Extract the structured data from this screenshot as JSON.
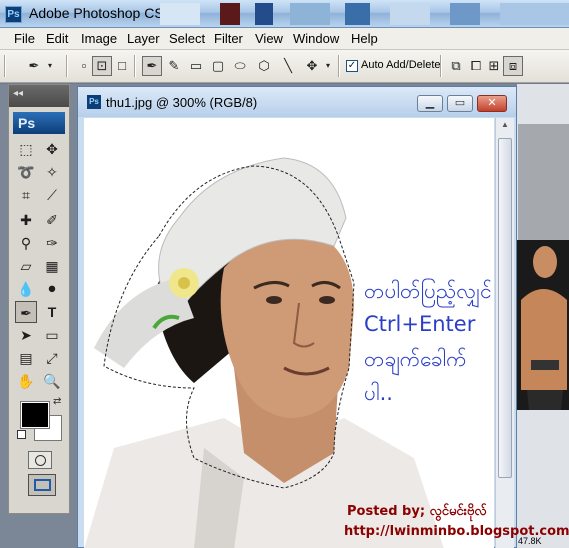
{
  "app": {
    "title": "Adobe Photoshop CS3",
    "logo": "Ps"
  },
  "menu": [
    "File",
    "Edit",
    "Image",
    "Layer",
    "Select",
    "Filter",
    "View",
    "Window",
    "Help"
  ],
  "options": {
    "auto_add_delete_label": "Auto Add/Delete",
    "auto_add_delete_checked": true
  },
  "tools_panel": {
    "badge": "Ps",
    "collapse_arrows": "◂◂",
    "foreground_color": "#000000",
    "background_color": "#ffffff"
  },
  "document": {
    "title": "thu1.jpg @ 300% (RGB/8)"
  },
  "overlay": {
    "instruction_line1": "တပါတ်ပြည့်လျှင်",
    "instruction_line2": "Ctrl+Enter",
    "instruction_line3": "တချက်ခေါက်",
    "instruction_line4": "ပါ..",
    "posted_by": "Posted by; လွင်မင်းဗိုလ်",
    "blog_url": "http://lwinminbo.blogspot.com/"
  },
  "status": {
    "size": "47.8K"
  },
  "colors": {
    "overlay_text": "#2b3fc6",
    "credit_text": "#8b0000",
    "title_bar": "#a9c6e6",
    "close_button": "#c4412b"
  }
}
